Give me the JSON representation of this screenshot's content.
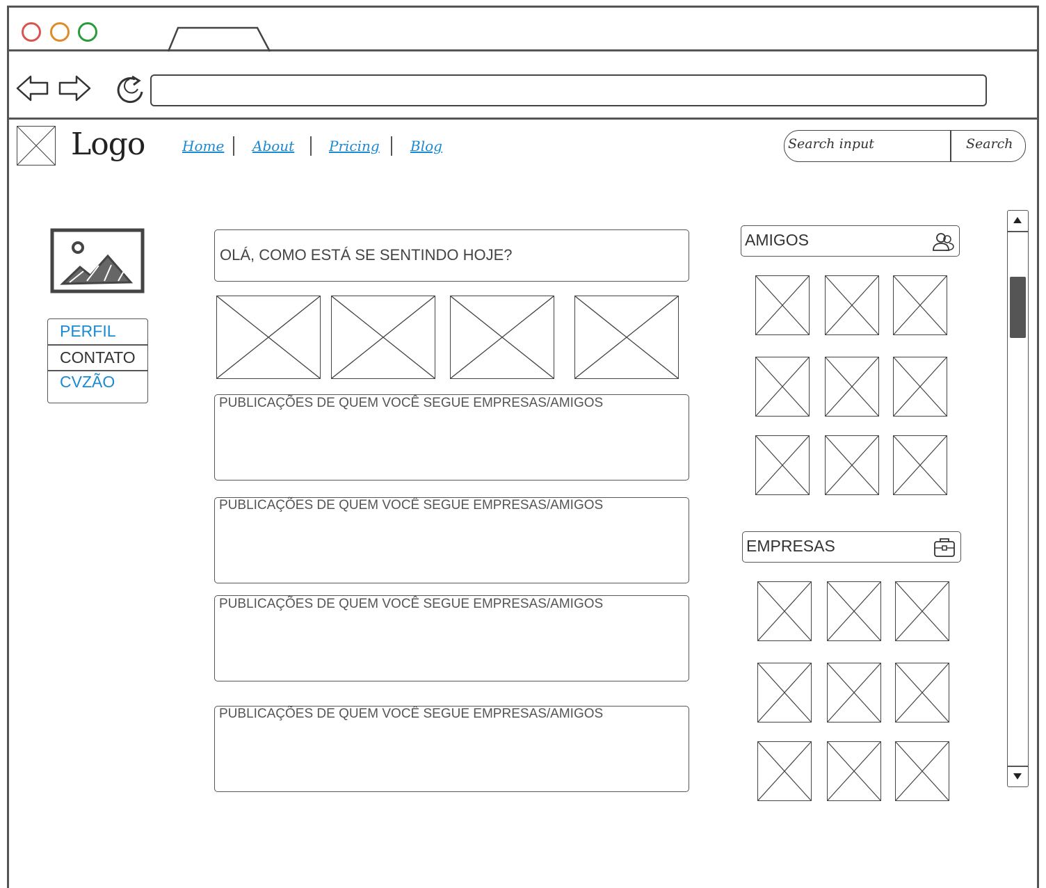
{
  "header": {
    "logo_text": "Logo",
    "nav": [
      "Home",
      "About",
      "Pricing",
      "Blog"
    ],
    "search_placeholder": "Search input",
    "search_button": "Search"
  },
  "sidebar": {
    "menu": [
      {
        "label": "PERFIL",
        "color": "#1a8ad4"
      },
      {
        "label": "CONTATO",
        "color": "#333333"
      },
      {
        "label": "CVZÃO",
        "color": "#1a8ad4"
      }
    ]
  },
  "main": {
    "status_prompt": "OLÁ, COMO ESTÁ SE SENTINDO HOJE?",
    "post_label": "PUBLICAÇÕES DE QUEM VOCÊ SEGUE EMPRESAS/AMIGOS"
  },
  "right": {
    "friends_title": "AMIGOS",
    "companies_title": "EMPRESAS"
  },
  "colors": {
    "window_close": "#d9534f",
    "window_minimize": "#e08a2a",
    "window_maximize": "#2a9a3a",
    "link": "#1a8ad4"
  }
}
